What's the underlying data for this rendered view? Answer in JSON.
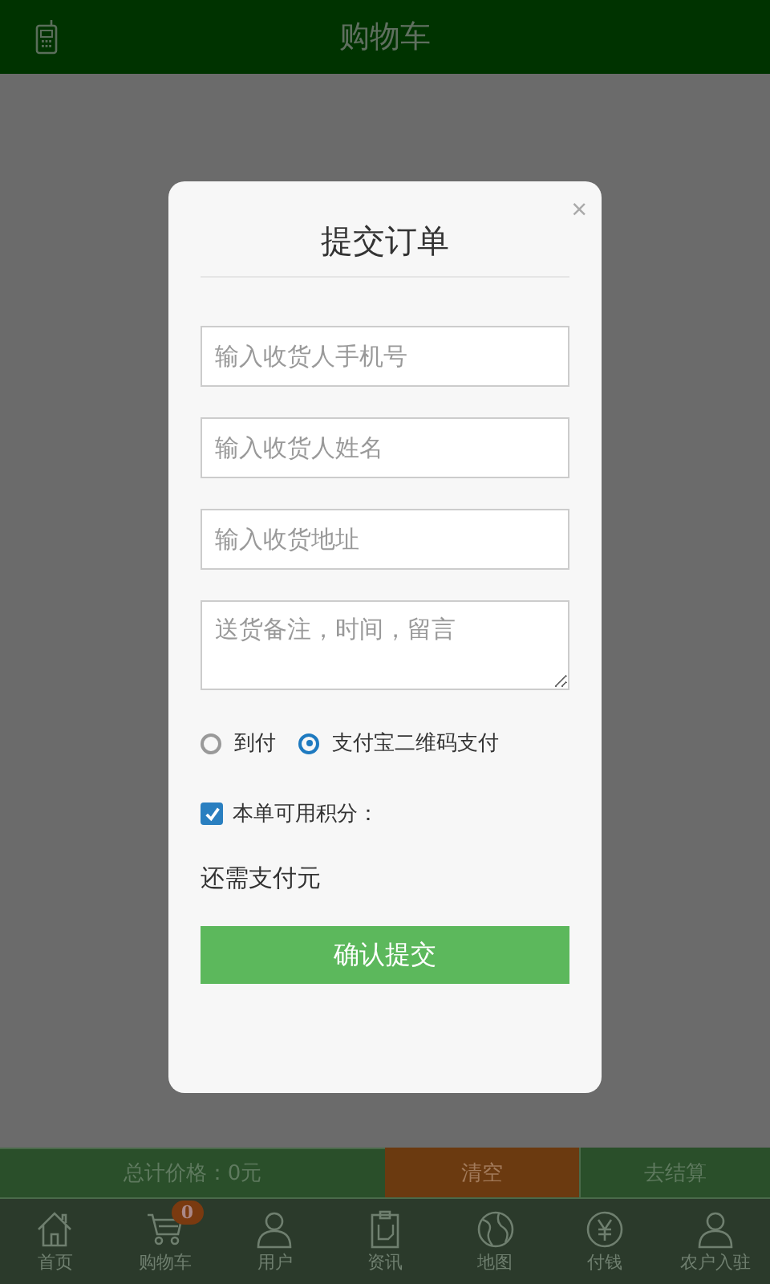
{
  "header": {
    "title": "购物车"
  },
  "dialog": {
    "title": "提交订单",
    "close": "×",
    "fields": [
      {
        "kind": "input",
        "placeholder": "输入收货人手机号"
      },
      {
        "kind": "input",
        "placeholder": "输入收货人姓名"
      },
      {
        "kind": "input",
        "placeholder": "输入收货地址"
      },
      {
        "kind": "textarea",
        "placeholder": "送货备注，时间，留言"
      }
    ],
    "payment": [
      {
        "label": "到付",
        "selected": false
      },
      {
        "label": "支付宝二维码支付",
        "selected": true
      }
    ],
    "points": {
      "label": "本单可用积分：",
      "checked": true
    },
    "due": "还需支付元",
    "submit": "确认提交"
  },
  "summary": {
    "total": "总计价格：0元",
    "clear": "清空",
    "checkout": "去结算"
  },
  "nav": [
    {
      "kind": "home",
      "label": "首页"
    },
    {
      "kind": "cart",
      "label": "购物车",
      "badge": "0"
    },
    {
      "kind": "user",
      "label": "用户"
    },
    {
      "kind": "news",
      "label": "资讯"
    },
    {
      "kind": "map",
      "label": "地图"
    },
    {
      "kind": "pay",
      "label": "付钱"
    },
    {
      "kind": "user",
      "label": "农户入驻"
    }
  ]
}
